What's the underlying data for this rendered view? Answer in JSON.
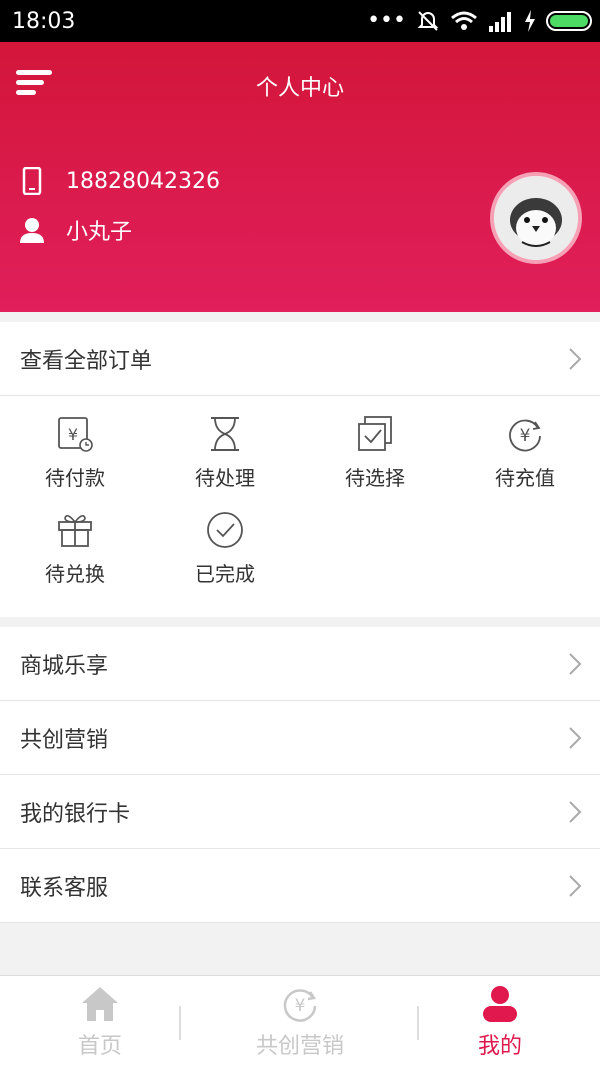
{
  "status_bar": {
    "time": "18:03"
  },
  "header": {
    "title": "个人中心",
    "phone": "18828042326",
    "username": "小丸子"
  },
  "orders": {
    "view_all_label": "查看全部订单",
    "items": [
      {
        "label": "待付款",
        "icon": "yen-clock-icon"
      },
      {
        "label": "待处理",
        "icon": "hourglass-icon"
      },
      {
        "label": "待选择",
        "icon": "checkbox-stack-icon"
      },
      {
        "label": "待充值",
        "icon": "yen-refresh-icon"
      },
      {
        "label": "待兑换",
        "icon": "gift-icon"
      },
      {
        "label": "已完成",
        "icon": "check-circle-icon"
      }
    ]
  },
  "menu": [
    {
      "label": "商城乐享"
    },
    {
      "label": "共创营销"
    },
    {
      "label": "我的银行卡"
    },
    {
      "label": "联系客服"
    }
  ],
  "tabbar": [
    {
      "label": "首页",
      "icon": "home-icon",
      "active": false
    },
    {
      "label": "共创营销",
      "icon": "yen-refresh-icon",
      "active": false
    },
    {
      "label": "我的",
      "icon": "user-icon",
      "active": true
    }
  ],
  "colors": {
    "accent": "#e0184d",
    "header_top": "#d3163a",
    "header_bottom": "#e01f5b"
  }
}
